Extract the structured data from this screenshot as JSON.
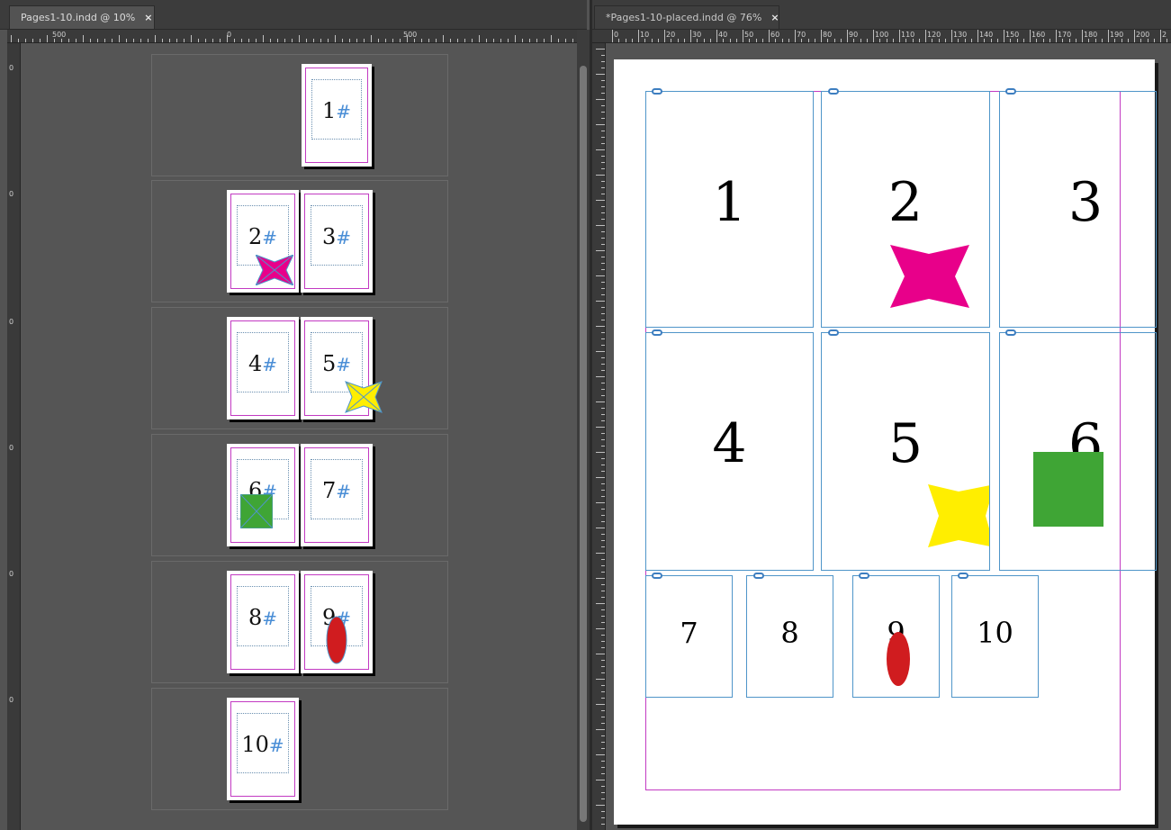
{
  "left_tab": {
    "title": "Pages1-10.indd @ 10%",
    "close": "×"
  },
  "right_tab": {
    "title": "*Pages1-10-placed.indd @ 76%",
    "close": "×"
  },
  "left_ruler": {
    "labels": [
      "500",
      "0",
      "500"
    ],
    "vlabels": [
      "0",
      "0",
      "0",
      "0",
      "0",
      "0"
    ]
  },
  "right_ruler": {
    "labels": [
      "0",
      "10",
      "20",
      "30",
      "40",
      "50",
      "60",
      "70",
      "80",
      "90",
      "100",
      "110",
      "120",
      "130",
      "140",
      "150",
      "160",
      "170",
      "180",
      "190",
      "200",
      "2"
    ]
  },
  "pages_panel": {
    "pages": [
      {
        "num": "1",
        "hash": "#"
      },
      {
        "num": "2",
        "hash": "#"
      },
      {
        "num": "3",
        "hash": "#"
      },
      {
        "num": "4",
        "hash": "#"
      },
      {
        "num": "5",
        "hash": "#"
      },
      {
        "num": "6",
        "hash": "#"
      },
      {
        "num": "7",
        "hash": "#"
      },
      {
        "num": "8",
        "hash": "#"
      },
      {
        "num": "9",
        "hash": "#"
      },
      {
        "num": "10",
        "hash": "#"
      }
    ]
  },
  "placed_doc": {
    "numbers": [
      "1",
      "2",
      "3",
      "4",
      "5",
      "6",
      "7",
      "8",
      "9",
      "10"
    ]
  },
  "colors": {
    "magenta": "#e8008a",
    "yellow": "#ffee00",
    "green": "#3fa535",
    "red": "#d01c1f",
    "frame": "#4f95c9",
    "margin": "#c23ac2"
  }
}
